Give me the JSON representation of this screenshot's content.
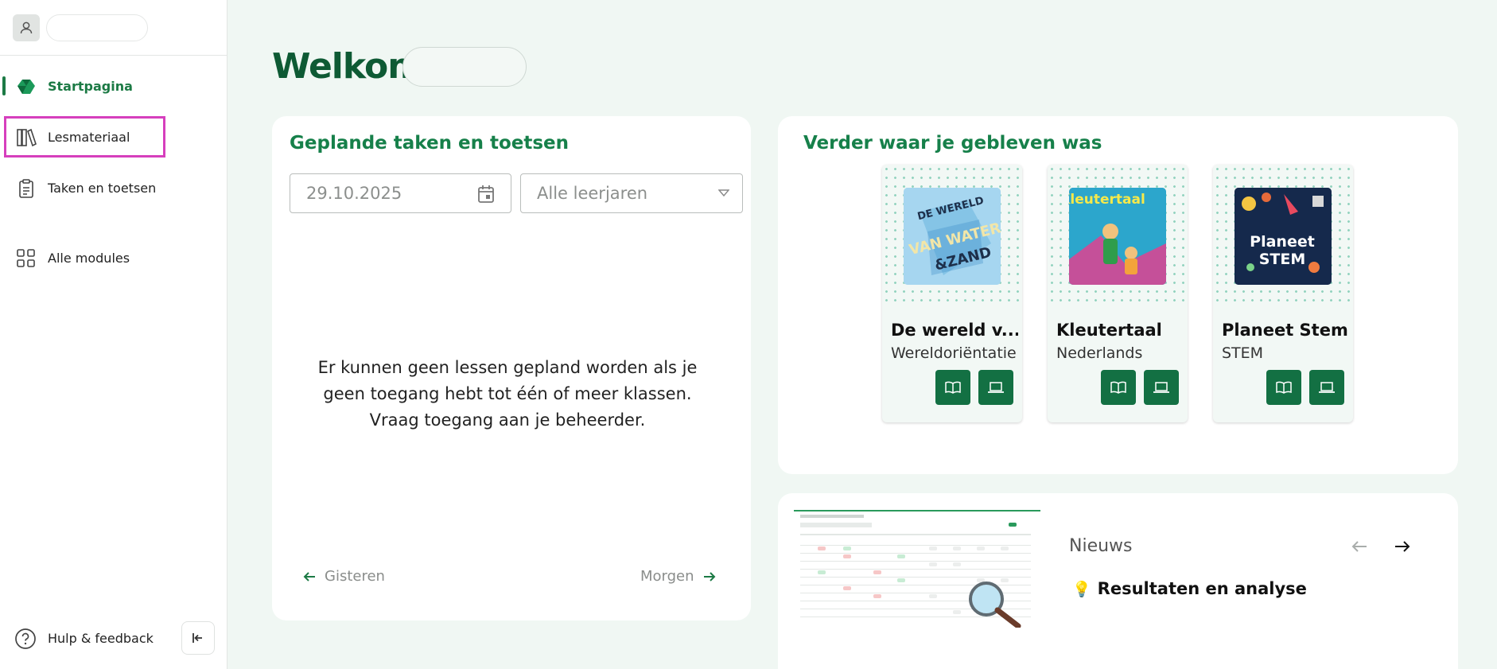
{
  "sidebar": {
    "nav": {
      "home": "Startpagina",
      "materials": "Lesmateriaal",
      "tasks": "Taken en toetsen",
      "modules": "Alle modules"
    },
    "help": "Hulp & feedback",
    "icons": [
      "user-icon",
      "home-logo-icon",
      "books-icon",
      "clipboard-icon",
      "grid-icon",
      "help-icon",
      "collapse-icon"
    ]
  },
  "main": {
    "welcome": "Welkom",
    "planned": {
      "title": "Geplande taken en toetsen",
      "date_value": "29.10.2025",
      "grade_select": "Alle leerjaren",
      "empty_line1": "Er kunnen geen lessen gepland worden als je",
      "empty_line2": "geen toegang hebt tot één of meer klassen.",
      "empty_line3": "Vraag toegang aan je beheerder.",
      "prev": "Gisteren",
      "next": "Morgen"
    },
    "continue": {
      "title": "Verder waar je gebleven was",
      "books": [
        {
          "title": "De wereld v...",
          "subject": "Wereldoriëntatie",
          "cover_text": "DE WERELD VAN WATER & ZAND"
        },
        {
          "title": "Kleutertaal",
          "subject": "Nederlands",
          "cover_text": "Kleutertaal"
        },
        {
          "title": "Planeet Stem",
          "subject": "STEM",
          "cover_text": "Planeet STEM"
        }
      ]
    },
    "news": {
      "label": "Nieuws",
      "item_icon": "💡",
      "item_title": "Resultaten en analyse"
    }
  },
  "colors": {
    "brand_green": "#0e5a34",
    "accent_green": "#16804a",
    "button_green": "#137043",
    "highlight": "#d63fbd",
    "background": "#f0f7f3"
  }
}
